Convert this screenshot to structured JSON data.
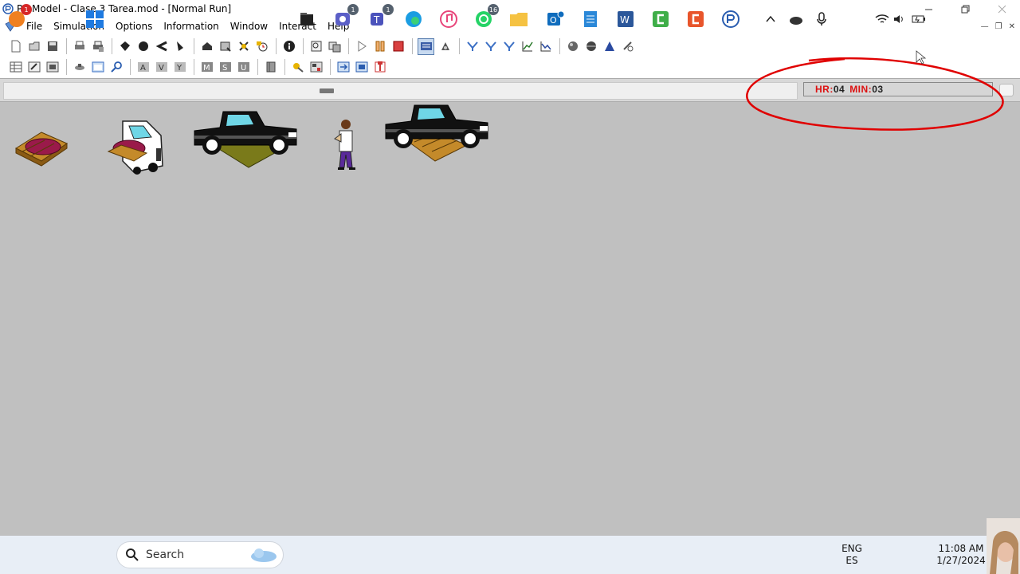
{
  "window": {
    "title": "ProModel - Clase 3 Tarea.mod - [Normal Run]",
    "controls": [
      "minimize",
      "restore",
      "close"
    ]
  },
  "menu": {
    "items": [
      "File",
      "Simulation",
      "Options",
      "Information",
      "Window",
      "Interact",
      "Help"
    ]
  },
  "sim_clock": {
    "hr_label": "HR:",
    "hr_value": "04",
    "min_label": "MIN:",
    "min_value": "03"
  },
  "annotation": {
    "color": "#e00000",
    "shape": "ellipse"
  },
  "toolbar1": {
    "icons": [
      "new-icon",
      "open-icon",
      "save-icon",
      "print-icon",
      "print-setup-icon",
      "location-icon",
      "entity-icon",
      "path-icon",
      "resource-icon",
      "processing-icon",
      "arrivals-icon",
      "shifts-icon",
      "info-icon",
      "zoom-icon",
      "layout-icon",
      "play-icon",
      "pause-icon",
      "stop-icon",
      "animation-icon",
      "trace-icon",
      "filter-icon",
      "filter2-icon",
      "filter3-icon",
      "chart-icon",
      "chart2-icon",
      "sphere-icon",
      "globe-icon",
      "triangle-icon",
      "tools-icon"
    ]
  },
  "toolbar2": {
    "icons": [
      "table-icon",
      "edit-icon",
      "copy-icon",
      "link-icon",
      "view-icon",
      "search-icon",
      "a-icon",
      "v-icon",
      "y-icon",
      "m-icon",
      "s-icon",
      "u-icon",
      "book-icon",
      "pencil-icon",
      "graphics-icon",
      "layout-edit-icon",
      "export-icon",
      "import-icon"
    ]
  },
  "entities": [
    "pallet-icon",
    "forklift-icon",
    "truck-with-pallet-icon",
    "worker-icon",
    "truck-icon"
  ],
  "taskbar": {
    "search_placeholder": "Search",
    "apps": [
      "windows-start-icon",
      "notification-icon",
      "file-manager-icon",
      "teams-meeting-icon",
      "teams-icon",
      "edge-icon",
      "music-icon",
      "whatsapp-icon",
      "folder-icon",
      "outlook-icon",
      "notepad-icon",
      "word-icon",
      "camtasia-icon",
      "capcut-icon",
      "promodel-icon"
    ],
    "badges": {
      "notification": "1",
      "teams_meeting": "1",
      "teams": "1",
      "whatsapp": "16"
    },
    "language": "ENG",
    "layout": "ES",
    "time": "11:08 AM",
    "date": "1/27/2024"
  }
}
